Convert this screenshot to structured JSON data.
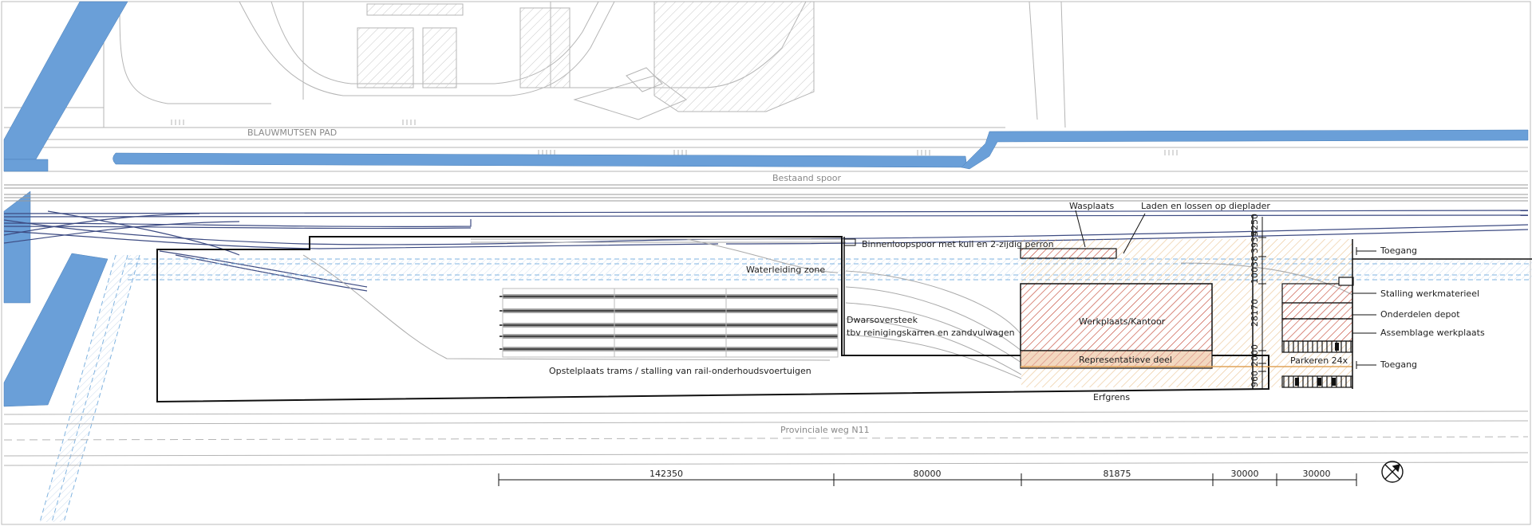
{
  "labels": {
    "street": "BLAUWMUTSEN PAD",
    "existing_track": "Bestaand spoor",
    "wash": "Wasplaats",
    "loading": "Laden en lossen op dieplader",
    "inner_track": "Binnenloopspoor met kuil en 2-zijdig perron",
    "water_zone": "Waterleiding zone",
    "crossing_line1": "Dwarsoversteek",
    "crossing_line2": "tbv reinigingskarren en zandvulwagen",
    "storage": "Opstelplaats trams / stalling van rail-onderhoudsvoertuigen",
    "workshop": "Werkplaats/Kantoor",
    "representative": "Representatieve deel",
    "parking": "Parkeren 24x",
    "property_line": "Erfgrens",
    "road": "Provinciale weg N11"
  },
  "legend": {
    "access_top": "Toegang",
    "equipment": "Stalling werkmaterieel",
    "parts": "Onderdelen depot",
    "assembly": "Assemblage werkplaats",
    "access_bottom": "Toegang"
  },
  "dims_vertical": [
    "3935",
    "4250",
    "10038",
    "28170",
    "2000",
    "960"
  ],
  "dims_horizontal": [
    "142350",
    "80000",
    "81875",
    "30000",
    "30000"
  ],
  "colors": {
    "water": "#6a9fd8",
    "track": "#3d4b82",
    "building_hatch": "#c03a3a",
    "site_hatch": "#e0a458",
    "outline": "#111111",
    "grey": "#9a9a9a"
  },
  "icons": {
    "north": "north-arrow-icon"
  }
}
